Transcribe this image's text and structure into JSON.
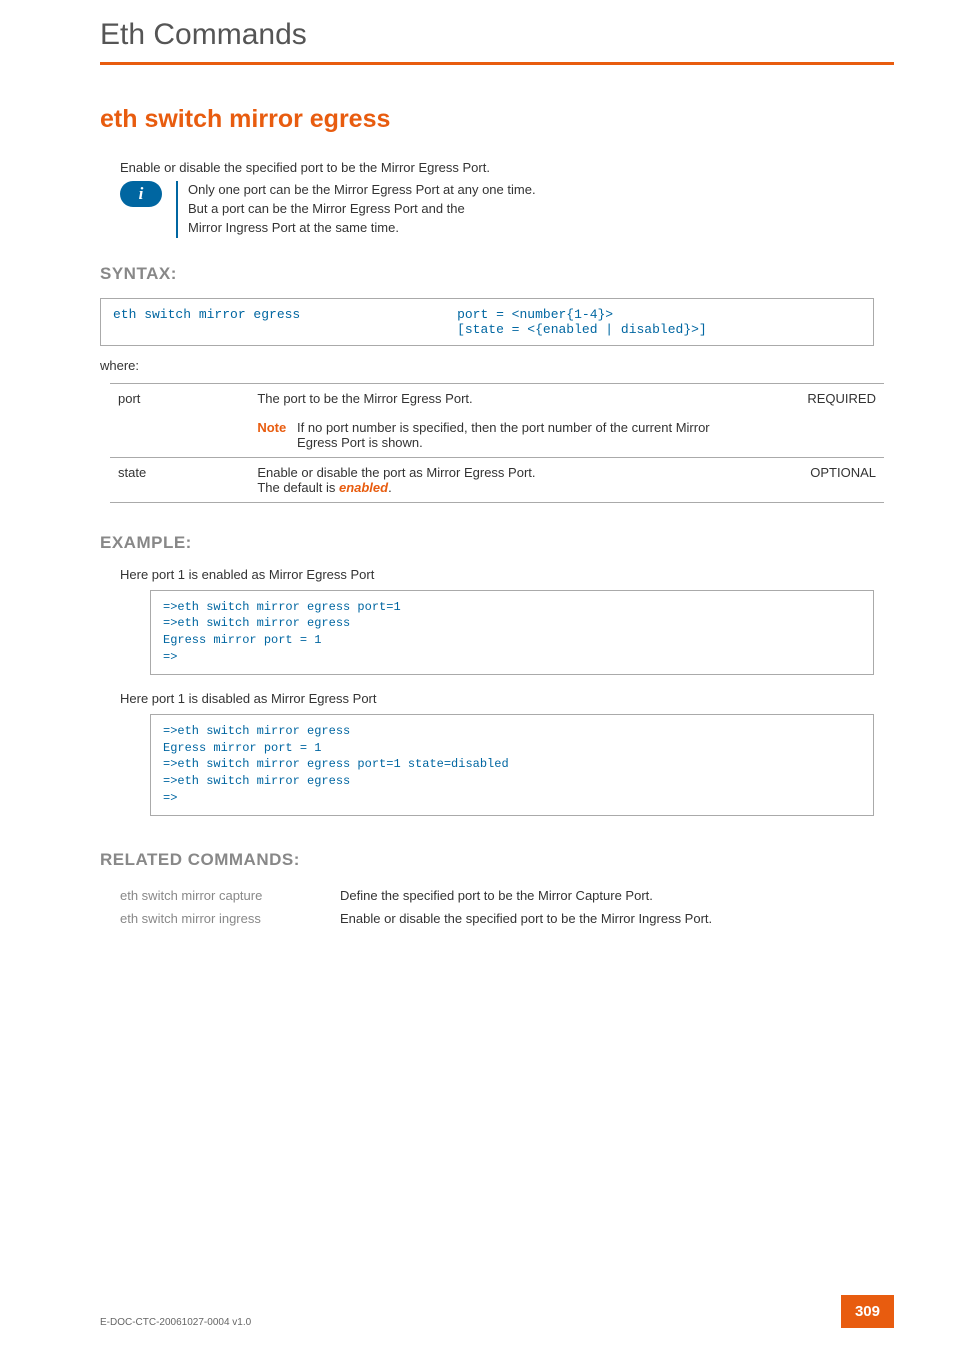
{
  "page_title": "Eth Commands",
  "command_heading": "eth switch mirror egress",
  "intro": "Enable or disable the specified port to be the Mirror Egress Port.",
  "info_note": {
    "line1": "Only one port can be the Mirror Egress Port at any one time.",
    "line2": "But a port can be the Mirror Egress Port and the",
    "line3": "Mirror Ingress Port at the same time."
  },
  "sections": {
    "syntax_label": "SYNTAX:",
    "example_label": "EXAMPLE:",
    "related_label": "RELATED COMMANDS:"
  },
  "syntax": {
    "left": "eth switch mirror egress",
    "right_line1": "port = <number{1-4}>",
    "right_line2": "[state = <{enabled | disabled}>]"
  },
  "where_label": "where:",
  "params": [
    {
      "name": "port",
      "desc": "The port to be the Mirror Egress Port.",
      "req": "REQUIRED",
      "note_prefix": "Note",
      "note_text": "If no port number is specified, then the port number of the current Mirror Egress Port is shown."
    },
    {
      "name": "state",
      "desc_prefix": "Enable or disable the port as Mirror Egress Port.",
      "desc_line2a": "The default is ",
      "desc_line2b": "enabled",
      "desc_line2c": ".",
      "req": "OPTIONAL"
    }
  ],
  "example": {
    "intro1": "Here port 1 is enabled as Mirror Egress Port",
    "code1": "=>eth switch mirror egress port=1\n=>eth switch mirror egress\nEgress mirror port = 1\n=>",
    "intro2": "Here port 1 is disabled as Mirror Egress Port",
    "code2": "=>eth switch mirror egress\nEgress mirror port = 1\n=>eth switch mirror egress port=1 state=disabled\n=>eth switch mirror egress\n=>"
  },
  "related": [
    {
      "cmd": "eth switch mirror capture",
      "desc": "Define the specified port to be the Mirror Capture Port."
    },
    {
      "cmd": "eth switch mirror ingress",
      "desc": "Enable or disable the specified port to be the Mirror Ingress Port."
    }
  ],
  "footer": {
    "doc_id": "E-DOC-CTC-20061027-0004 v1.0",
    "page_num": "309"
  }
}
